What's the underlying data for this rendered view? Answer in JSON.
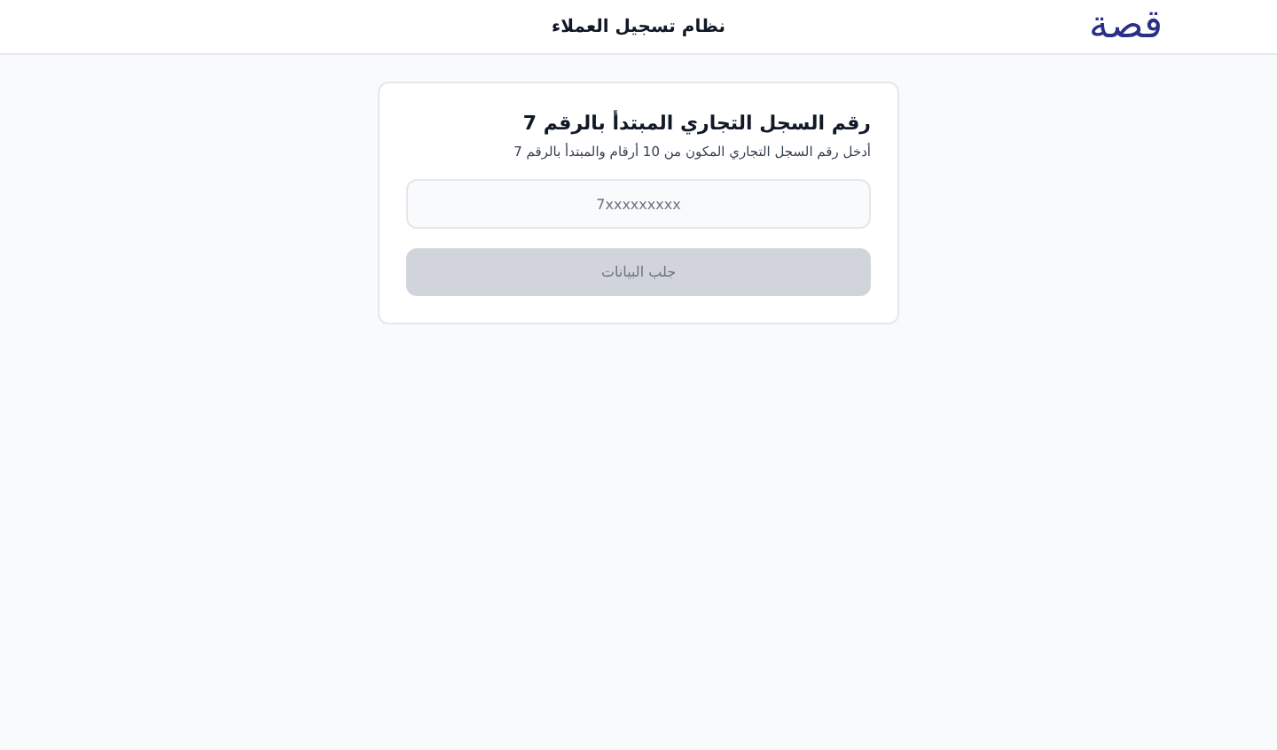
{
  "header": {
    "logo": "قصة",
    "title": "نظام تسجيل العملاء"
  },
  "card": {
    "title": "رقم السجل التجاري المبتدأ بالرقم 7",
    "subtitle": "أدخل رقم السجل التجاري المكون من 10 أرقام والمبتدأ بالرقم 7",
    "input": {
      "placeholder": "7xxxxxxxxx"
    },
    "button": {
      "label": "جلب البيانات",
      "disabled": true
    }
  }
}
